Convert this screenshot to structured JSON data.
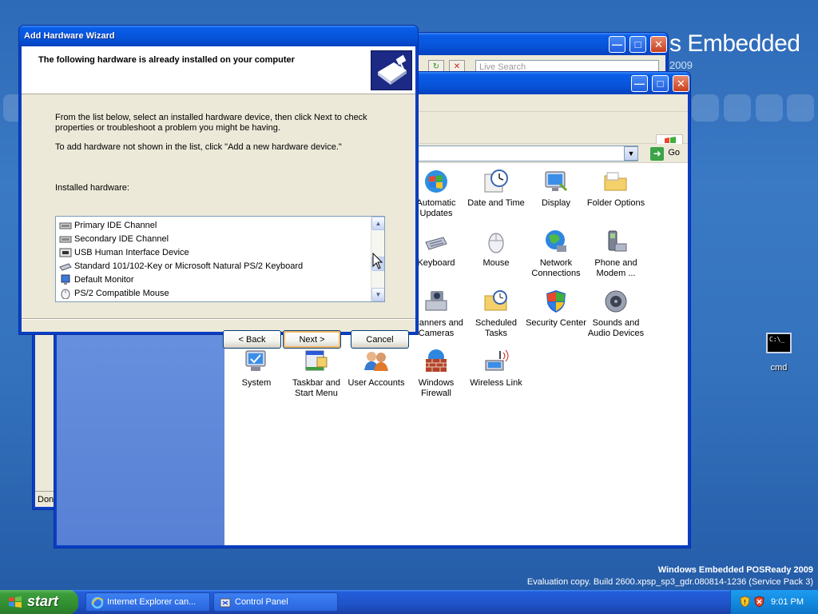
{
  "desktop": {
    "brand_suffix": "s Embedded",
    "brand_year": "2009",
    "footer_title": "Windows Embedded POSReady 2009",
    "footer_build": "Evaluation copy. Build 2600.xpsp_sp3_gdr.080814-1236 (Service Pack 3)",
    "cmd_icon_label": "cmd",
    "cmd_icon_text": "C:\\_"
  },
  "ie_window": {
    "status_text": "Done",
    "search_placeholder": "Live Search"
  },
  "control_panel": {
    "go_label": "Go",
    "icons": [
      {
        "label": "Automatic Updates",
        "icon": "automatic-updates-icon"
      },
      {
        "label": "Date and Time",
        "icon": "date-time-icon"
      },
      {
        "label": "Display",
        "icon": "display-icon"
      },
      {
        "label": "Folder Options",
        "icon": "folder-options-icon"
      },
      {
        "label": "Keyboard",
        "icon": "keyboard-icon"
      },
      {
        "label": "Mouse",
        "icon": "mouse-icon"
      },
      {
        "label": "Network Connections",
        "icon": "network-connections-icon"
      },
      {
        "label": "Phone and Modem ...",
        "icon": "phone-modem-icon"
      },
      {
        "label": "Scanners and Cameras",
        "icon": "scanners-cameras-icon"
      },
      {
        "label": "Scheduled Tasks",
        "icon": "scheduled-tasks-icon"
      },
      {
        "label": "Security Center",
        "icon": "security-center-icon"
      },
      {
        "label": "Sounds and Audio Devices",
        "icon": "sounds-audio-icon"
      },
      {
        "label": "System",
        "icon": "system-icon"
      },
      {
        "label": "Taskbar and Start Menu",
        "icon": "taskbar-start-menu-icon"
      },
      {
        "label": "User Accounts",
        "icon": "user-accounts-icon"
      },
      {
        "label": "Windows Firewall",
        "icon": "windows-firewall-icon"
      },
      {
        "label": "Wireless Link",
        "icon": "wireless-link-icon"
      }
    ]
  },
  "wizard": {
    "title": "Add Hardware Wizard",
    "heading": "The following hardware is already installed on your computer",
    "intro_line1": "From the list below, select an installed hardware device, then click Next to check",
    "intro_line2": "properties or troubleshoot a problem you might be having.",
    "add_hint": "To add hardware not shown in the list, click \"Add a new hardware device.\"",
    "list_label": "Installed hardware:",
    "hardware": [
      {
        "label": "Primary IDE Channel",
        "icon": "ide-channel-icon"
      },
      {
        "label": "Secondary IDE Channel",
        "icon": "ide-channel-icon"
      },
      {
        "label": "USB Human Interface Device",
        "icon": "usb-device-icon"
      },
      {
        "label": "Standard 101/102-Key or Microsoft Natural PS/2 Keyboard",
        "icon": "keyboard-icon"
      },
      {
        "label": "Default Monitor",
        "icon": "monitor-icon"
      },
      {
        "label": "PS/2 Compatible Mouse",
        "icon": "mouse-icon"
      }
    ],
    "back_label": "< Back",
    "next_label": "Next >",
    "cancel_label": "Cancel"
  },
  "taskbar": {
    "start_label": "start",
    "tasks": [
      {
        "label": "Internet Explorer can...",
        "icon": "internet-explorer-icon"
      },
      {
        "label": "Control Panel",
        "icon": "control-panel-icon"
      }
    ],
    "clock": "9:01 PM"
  },
  "colors": {
    "title_blue": "#0754d9",
    "task_pane_blue": "#6891df",
    "start_green": "#3c9d3c",
    "tray_blue": "#128ae0"
  }
}
